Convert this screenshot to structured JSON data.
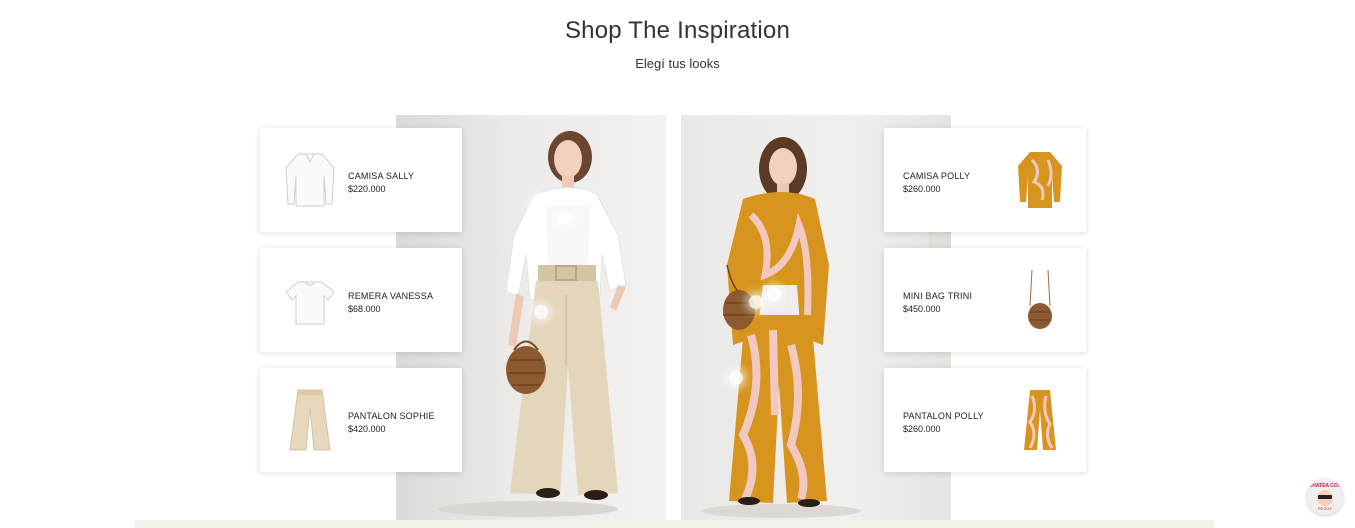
{
  "section": {
    "title": "Shop The Inspiration",
    "subtitle": "Elegí tus looks"
  },
  "looks": [
    {
      "products": [
        {
          "name": "CAMISA SALLY",
          "price": "$220.000",
          "icon": "white-shirt-icon"
        },
        {
          "name": "REMERA VANESSA",
          "price": "$68.000",
          "icon": "white-tshirt-icon"
        },
        {
          "name": "PANTALON SOPHIE",
          "price": "$420.000",
          "icon": "beige-pants-icon"
        }
      ]
    },
    {
      "products": [
        {
          "name": "CAMISA POLLY",
          "price": "$260.000",
          "icon": "printed-shirt-icon"
        },
        {
          "name": "MINI BAG TRINI",
          "price": "$450.000",
          "icon": "brown-bag-icon"
        },
        {
          "name": "PANTALON POLLY",
          "price": "$260.000",
          "icon": "printed-pants-icon"
        }
      ]
    }
  ],
  "chat_widget": {
    "label_top": "CHATEA CON",
    "label_bottom": "PEGGY",
    "icon": "chat-avatar-icon"
  },
  "colors": {
    "print_orange": "#d7951f",
    "print_pink": "#f2c8c0",
    "beige": "#e6d7bd",
    "leather": "#8b5a30"
  }
}
